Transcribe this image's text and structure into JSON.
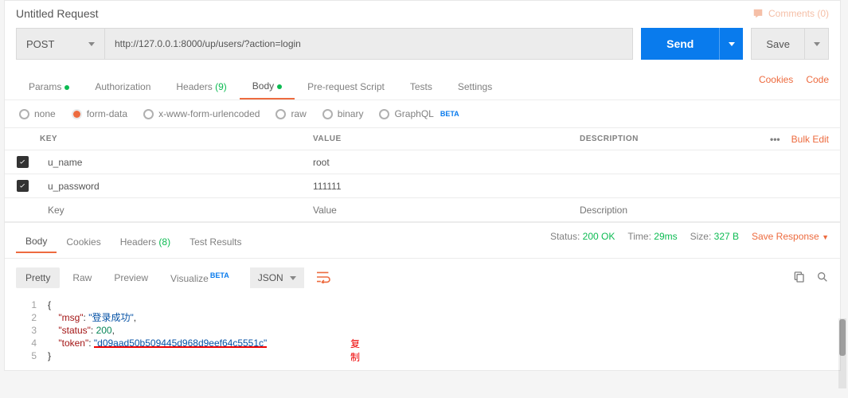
{
  "title": "Untitled Request",
  "comments": {
    "label": "Comments (0)"
  },
  "request": {
    "method": "POST",
    "url": "http://127.0.0.1:8000/up/users/?action=login",
    "send_label": "Send",
    "save_label": "Save"
  },
  "reqTabs": {
    "params": "Params",
    "authorization": "Authorization",
    "headers": "Headers",
    "headers_count": "(9)",
    "body": "Body",
    "prerequest": "Pre-request Script",
    "tests": "Tests",
    "settings": "Settings",
    "cookies": "Cookies",
    "code": "Code"
  },
  "bodyTypes": {
    "none": "none",
    "formdata": "form-data",
    "xwww": "x-www-form-urlencoded",
    "raw": "raw",
    "binary": "binary",
    "graphql": "GraphQL",
    "beta": "BETA"
  },
  "formTable": {
    "head": {
      "key": "KEY",
      "value": "VALUE",
      "description": "DESCRIPTION",
      "bulk": "Bulk Edit"
    },
    "rows": [
      {
        "checked": true,
        "key": "u_name",
        "value": "root",
        "desc": ""
      },
      {
        "checked": true,
        "key": "u_password",
        "value": "111111",
        "desc": ""
      }
    ],
    "placeholders": {
      "key": "Key",
      "value": "Value",
      "desc": "Description"
    }
  },
  "respTabs": {
    "body": "Body",
    "cookies": "Cookies",
    "headers": "Headers",
    "headers_count": "(8)",
    "tests": "Test Results"
  },
  "respMeta": {
    "status_label": "Status:",
    "status_value": "200 OK",
    "time_label": "Time:",
    "time_value": "29ms",
    "size_label": "Size:",
    "size_value": "327 B",
    "save": "Save Response"
  },
  "respToolbar": {
    "pretty": "Pretty",
    "raw": "Raw",
    "preview": "Preview",
    "visualize": "Visualize",
    "beta": "BETA",
    "format": "JSON"
  },
  "respBody": {
    "msg_key": "\"msg\"",
    "msg_val": "\"登录成功\"",
    "status_key": "\"status\"",
    "status_val": "200",
    "token_key": "\"token\"",
    "token_val": "\"d09aad50b509445d968d9eef64c5551c\"",
    "copy": "复制"
  }
}
